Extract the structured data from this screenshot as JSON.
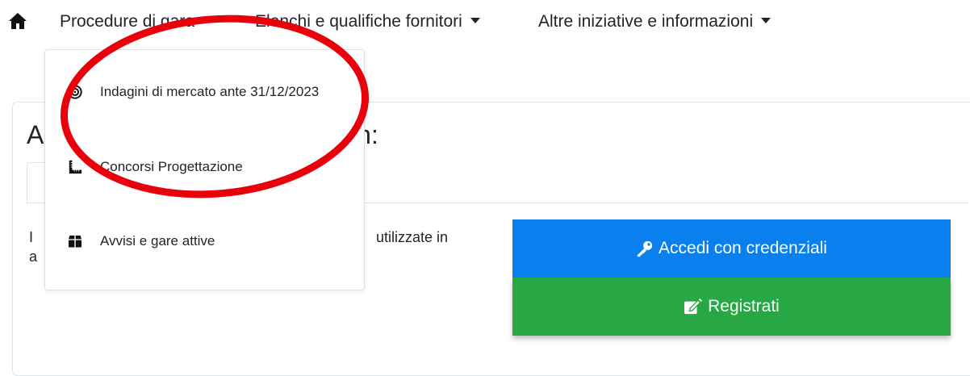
{
  "nav": {
    "items": [
      {
        "label": "Procedure di gara"
      },
      {
        "label": "Elenchi e qualifiche fornitori"
      },
      {
        "label": "Altre iniziative e informazioni"
      }
    ]
  },
  "dropdown": {
    "items": [
      {
        "label": "Indagini di mercato ante 31/12/2023",
        "icon": "bullseye-icon"
      },
      {
        "label": "Concorsi Progettazione",
        "icon": "ruler-icon"
      },
      {
        "label": "Avvisi e gare attive",
        "icon": "box-icon"
      }
    ]
  },
  "card": {
    "title_start": "A",
    "title_end": "on:",
    "text_line1_start": "I",
    "text_line1_end": "utilizzate in",
    "text_line2_start": "a"
  },
  "buttons": {
    "login_label": "Accedi con credenziali",
    "register_label": "Registrati"
  },
  "colors": {
    "login": "#0a80ef",
    "register": "#28a745",
    "annotation": "#e8000b"
  }
}
